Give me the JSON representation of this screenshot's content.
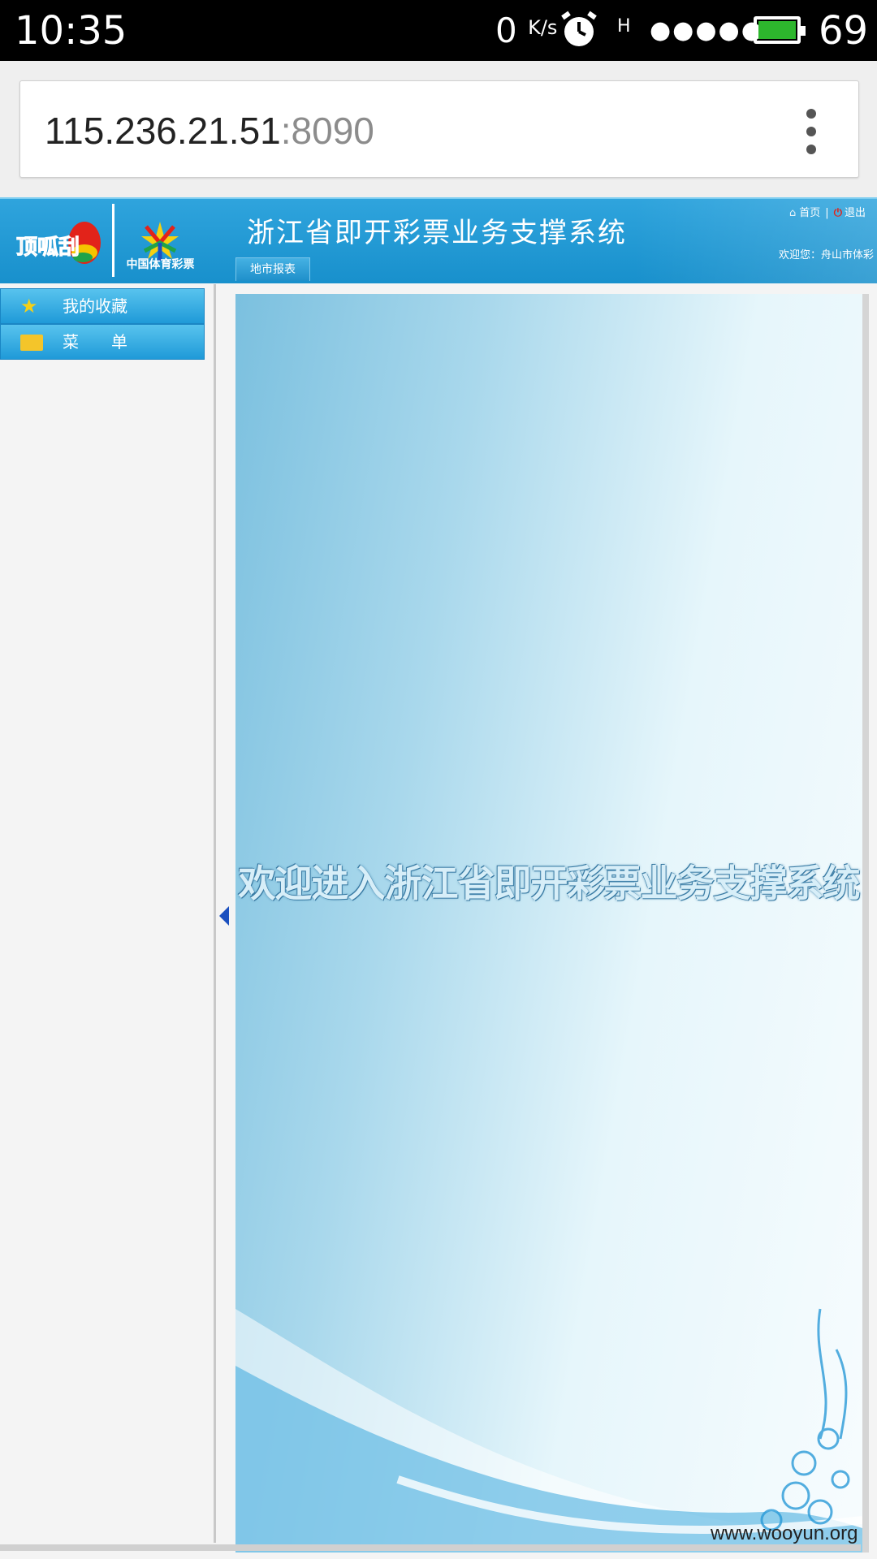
{
  "status_bar": {
    "time": "10:35",
    "speed_value": "0",
    "speed_unit": "K/s",
    "network": "H",
    "signal": "●●●●●",
    "battery_level": "69",
    "icons": [
      "alarm-icon",
      "battery-charging-icon"
    ]
  },
  "browser": {
    "url_host": "115.236.21.51",
    "url_port": ":8090",
    "menu_icon": "more-vert-icon"
  },
  "header": {
    "logo_text": "顶呱刮",
    "logo2_text": "中国体育彩票",
    "title": "浙江省即开彩票业务支撑系统",
    "tab_label": "地市报表",
    "home_link": "首页",
    "logout_link": "退出",
    "welcome": "欢迎您：舟山市体彩"
  },
  "sidebar": {
    "items": [
      {
        "label": "我的收藏",
        "icon": "star-icon"
      },
      {
        "label": "菜　　单",
        "icon": "folder-icon"
      }
    ]
  },
  "main": {
    "welcome_text": "欢迎进入浙江省即开彩票业务支撑系统"
  },
  "watermark": "www.wooyun.org",
  "colors": {
    "header_blue": "#1890cc",
    "sidebar_item": "#1f9ad8",
    "status_bar": "#000000",
    "battery_fill": "#2db62d"
  }
}
